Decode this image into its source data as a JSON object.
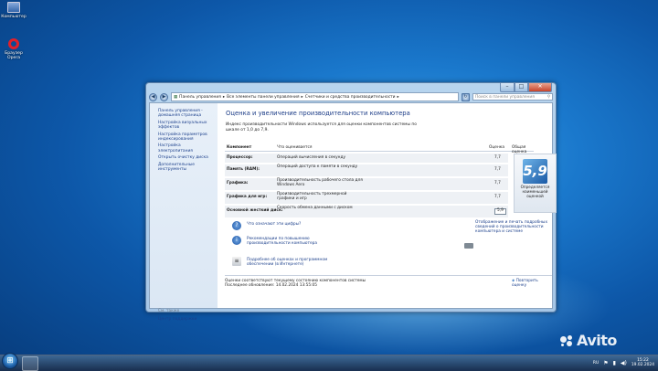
{
  "desktop": {
    "icons": [
      {
        "label": "Компьютер",
        "icon": "computer-icon"
      },
      {
        "label": "Браузер Opera",
        "icon": "opera-icon"
      }
    ]
  },
  "window": {
    "breadcrumb": [
      "Панель управления",
      "Все элементы панели управления",
      "Счетчики и средства производительности"
    ],
    "search_placeholder": "Поиск в панели управления",
    "sidebar": {
      "links": [
        "Панель управления - домашняя страница",
        "Настройка визуальных эффектов",
        "Настройка параметров индексирования",
        "Настройка электропитания",
        "Открыть очистку диска",
        "Дополнительные инструменты"
      ],
      "see_also_label": "См. также",
      "support_center": "Центр поддержки"
    },
    "main": {
      "title": "Оценка и увеличение производительности компьютера",
      "intro": "Индекс производительности Windows используется для оценки компонентов системы по шкале от 1,0 до 7,9.",
      "table_headers": {
        "component": "Компонент",
        "what": "Что оценивается",
        "score": "Оценка",
        "base": "Общая оценка"
      },
      "rows": [
        {
          "component": "Процессор:",
          "what": "Операций вычисления в секунду",
          "score": "7,7"
        },
        {
          "component": "Память (RAM):",
          "what": "Операций доступа к памяти в секунду",
          "score": "7,7"
        },
        {
          "component": "Графика:",
          "what": "Производительность рабочего стола для Windows Aero",
          "score": "7,7"
        },
        {
          "component": "Графика для игр:",
          "what": "Производительность трехмерной графики и игр",
          "score": "7,7"
        },
        {
          "component": "Основной жесткий диск:",
          "what": "Скорость обмена данными с диском",
          "score": "5,9"
        }
      ],
      "base_score": "5,9",
      "base_note": "Определяется наименьшей оценкой",
      "links": {
        "what_means": "Что означают эти цифры?",
        "tips": "Рекомендации по повышению производительности компьютера",
        "print": "Отображение и печать подробных сведений о производительности компьютера и системе",
        "online": "Подробнее об оценках и программном обеспечении (в Интернете)"
      },
      "status_line1": "Оценки соответствуют текущему состоянию компонентов системы",
      "status_line2": "Последнее обновление: 14.02.2024 13:55:05",
      "rerun": "Повторить оценку"
    }
  },
  "taskbar": {
    "language": "RU",
    "time": "15:22",
    "date": "19.02.2024"
  },
  "watermark": "Avito",
  "colors": {
    "link": "#1b3f8b",
    "title": "#1c3c87",
    "desktop": "#1a78cc"
  }
}
